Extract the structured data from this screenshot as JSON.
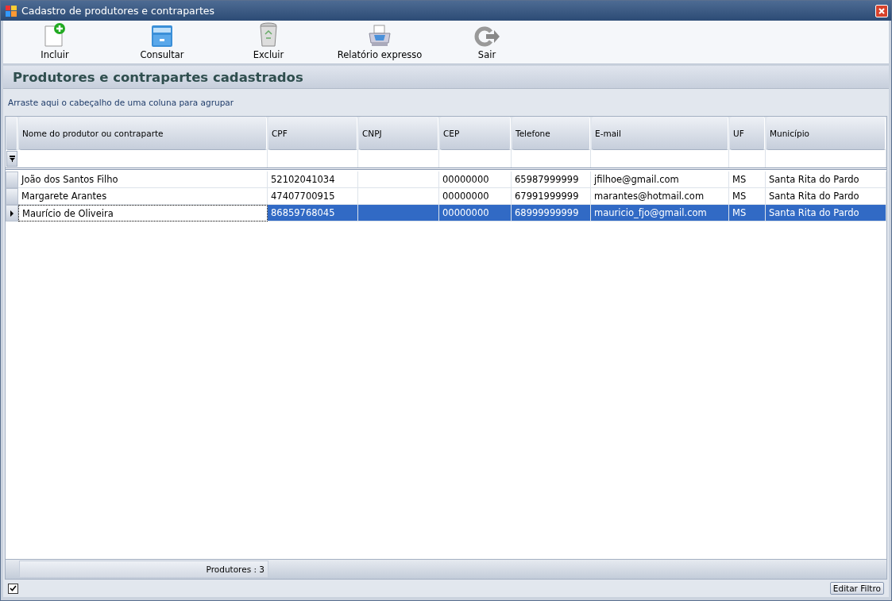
{
  "window": {
    "title": "Cadastro de produtores e contrapartes"
  },
  "toolbar": [
    {
      "label": "Incluir",
      "kind": "add"
    },
    {
      "label": "Consultar",
      "kind": "query"
    },
    {
      "label": "Excluir",
      "kind": "delete"
    },
    {
      "label": "Relatório expresso",
      "kind": "print"
    },
    {
      "label": "Sair",
      "kind": "exit"
    }
  ],
  "panel": {
    "title": "Produtores e contrapartes cadastrados",
    "group_hint": "Arraste aqui o cabeçalho de uma coluna para agrupar"
  },
  "table": {
    "columns": [
      "Nome do produtor ou contraparte",
      "CPF",
      "CNPJ",
      "CEP",
      "Telefone",
      "E-mail",
      "UF",
      "Município"
    ],
    "rows": [
      {
        "cells": [
          "João dos Santos Filho",
          "52102041034",
          "",
          "00000000",
          "65987999999",
          "jfilhoe@gmail.com",
          "MS",
          "Santa Rita do Pardo"
        ],
        "selected": false
      },
      {
        "cells": [
          "Margarete Arantes",
          "47407700915",
          "",
          "00000000",
          "67991999999",
          "marantes@hotmail.com",
          "MS",
          "Santa Rita do Pardo"
        ],
        "selected": false
      },
      {
        "cells": [
          "Maurício de Oliveira",
          "86859768045",
          "",
          "00000000",
          "68999999999",
          "mauricio_fjo@gmail.com",
          "MS",
          "Santa Rita do Pardo"
        ],
        "selected": true
      }
    ],
    "summary": "Produtores : 3"
  },
  "filter_checkbox": {
    "checked": true
  },
  "edit_filter_button": "Editar Filtro"
}
